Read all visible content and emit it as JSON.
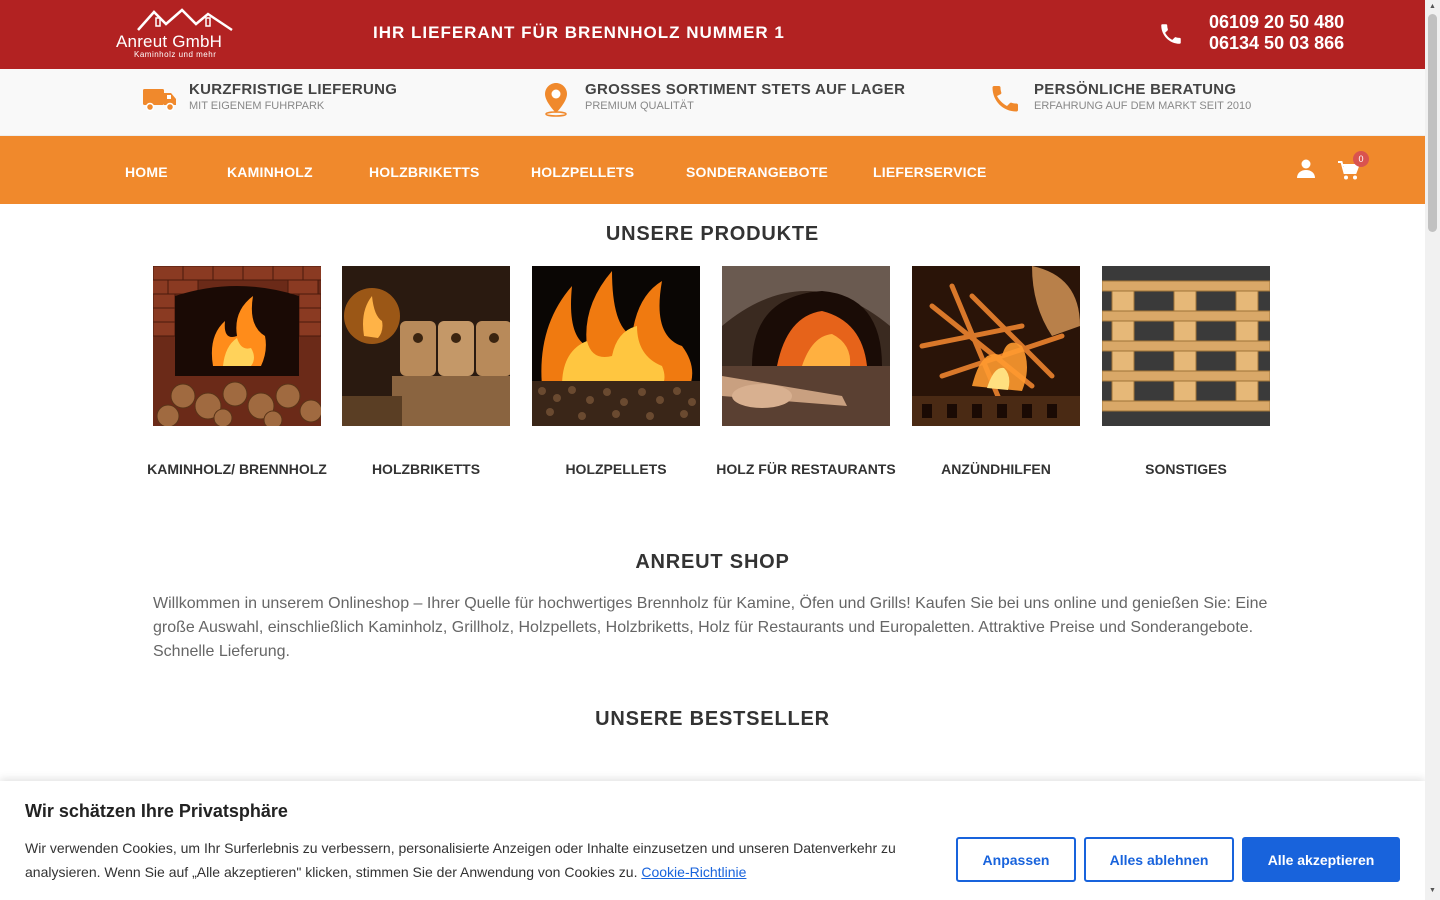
{
  "header": {
    "logo_text": "Anreut GmbH",
    "logo_sub": "Kaminholz und mehr",
    "tagline": "IHR LIEFERANT FÜR BRENNHOLZ NUMMER 1",
    "phone_1": "06109 20 50 480",
    "phone_2": "06134 50 03 866",
    "bg_color": "#b22222"
  },
  "features": [
    {
      "icon": "truck-icon",
      "title": "KURZFRISTIGE LIEFERUNG",
      "sub": "MIT EIGENEM FUHRPARK"
    },
    {
      "icon": "location-pin-icon",
      "title": "GROSSES SORTIMENT STETS AUF LAGER",
      "sub": "PREMIUM QUALITÄT"
    },
    {
      "icon": "phone-icon",
      "title": "PERSÖNLICHE BERATUNG",
      "sub": "ERFAHRUNG AUF DEM MARKT SEIT 2010"
    }
  ],
  "nav": {
    "items": [
      "HOME",
      "KAMINHOLZ",
      "HOLZBRIKETTS",
      "HOLZPELLETS",
      "SONDERANGEBOTE",
      "LIEFERSERVICE"
    ],
    "cart_count": "0",
    "accent_color": "#f0892c"
  },
  "products": {
    "heading": "UNSERE PRODUKTE",
    "items": [
      {
        "label": "KAMINHOLZ/ BRENNHOLZ",
        "image": "fireplace-with-logs"
      },
      {
        "label": "HOLZBRIKETTS",
        "image": "wood-briquettes"
      },
      {
        "label": "HOLZPELLETS",
        "image": "burning-pellets"
      },
      {
        "label": "HOLZ FÜR RESTAURANTS",
        "image": "pizza-oven"
      },
      {
        "label": "ANZÜNDHILFEN",
        "image": "kindling-fire"
      },
      {
        "label": "SONSTIGES",
        "image": "euro-pallets"
      }
    ]
  },
  "shop": {
    "heading": "ANREUT SHOP",
    "text": "Willkommen in unserem Onlineshop – Ihrer Quelle für hochwertiges Brennholz für Kamine, Öfen und Grills! Kaufen Sie bei uns online und genießen Sie: Eine große Auswahl, einschließlich Kaminholz, Grillholz, Holzpellets, Holzbriketts, Holz für Restaurants und Europaletten. Attraktive Preise und Sonderangebote. Schnelle Lieferung."
  },
  "bestseller": {
    "heading": "UNSERE BESTSELLER"
  },
  "cookie": {
    "title": "Wir schätzen Ihre Privatsphäre",
    "text": "Wir verwenden Cookies, um Ihr Surferlebnis zu verbessern, personalisierte Anzeigen oder Inhalte einzusetzen und unseren Datenverkehr zu analysieren. Wenn Sie auf „Alle akzeptieren\" klicken, stimmen Sie der Anwendung von Cookies zu.",
    "link": "Cookie-Richtlinie",
    "btn_customize": "Anpassen",
    "btn_reject": "Alles ablehnen",
    "btn_accept": "Alle akzeptieren",
    "accent_color": "#1863dc"
  }
}
